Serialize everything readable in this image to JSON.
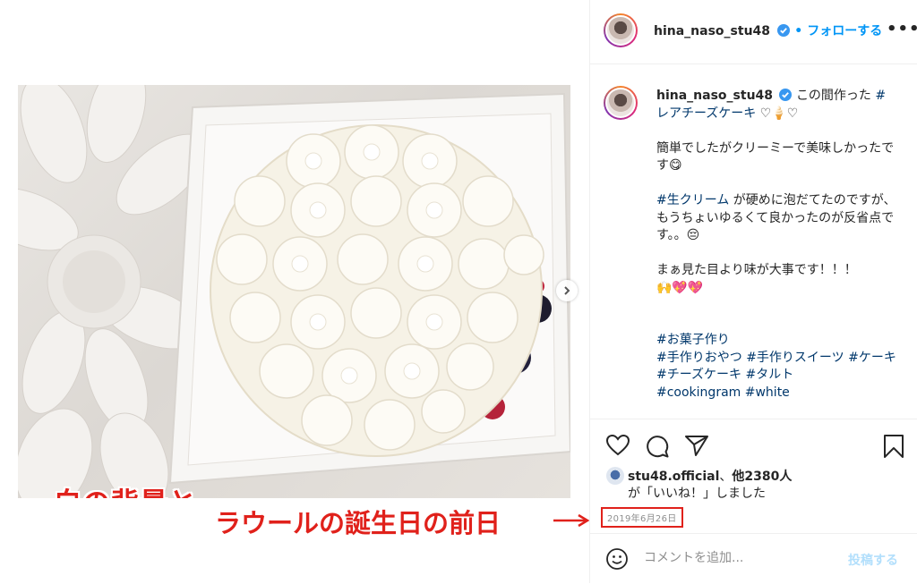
{
  "post": {
    "username": "hina_naso_stu48",
    "follow_prefix": "•",
    "follow_label": "フォローする",
    "more_label": "•••",
    "caption_lines": [
      "この間作った",
      "#レアチーズケーキ",
      "♡🍦♡",
      "簡単でしたがクリーミーで美味しかったです😋",
      "#生クリーム",
      "が硬めに泡だてたのですが、もうちょいゆるくて良かったのが反省点です。。😔",
      "まぁ見た目より味が大事です！！！",
      "🙌💖💖"
    ],
    "hashtags": [
      "#お菓子作り",
      "#手作りおやつ",
      "#手作りスイーツ",
      "#ケーキ",
      "#チーズケーキ",
      "#タルト",
      "#cookingram",
      "#white"
    ],
    "likes_by": "stu48.official",
    "likes_sep": "、",
    "likes_others": "他2380人",
    "likes_suffix": "が「いいね！」しました",
    "date": "2019年6月26日",
    "comment_placeholder": "コメントを追加...",
    "post_button": "投稿する"
  },
  "overlay": {
    "photo_caption": "白の背景と\n真っ白なケーキ",
    "note": "ラウールの誕生日の前日",
    "note_arrow": "→"
  },
  "colors": {
    "accent_red": "#e0211b",
    "link_blue": "#0095f6",
    "hashtag_blue": "#00376b",
    "post_disabled": "#b2dffc"
  },
  "icons": [
    "heart-icon",
    "comment-icon",
    "share-icon",
    "bookmark-icon",
    "emoji-icon",
    "verified-icon",
    "chevron-right-icon"
  ]
}
